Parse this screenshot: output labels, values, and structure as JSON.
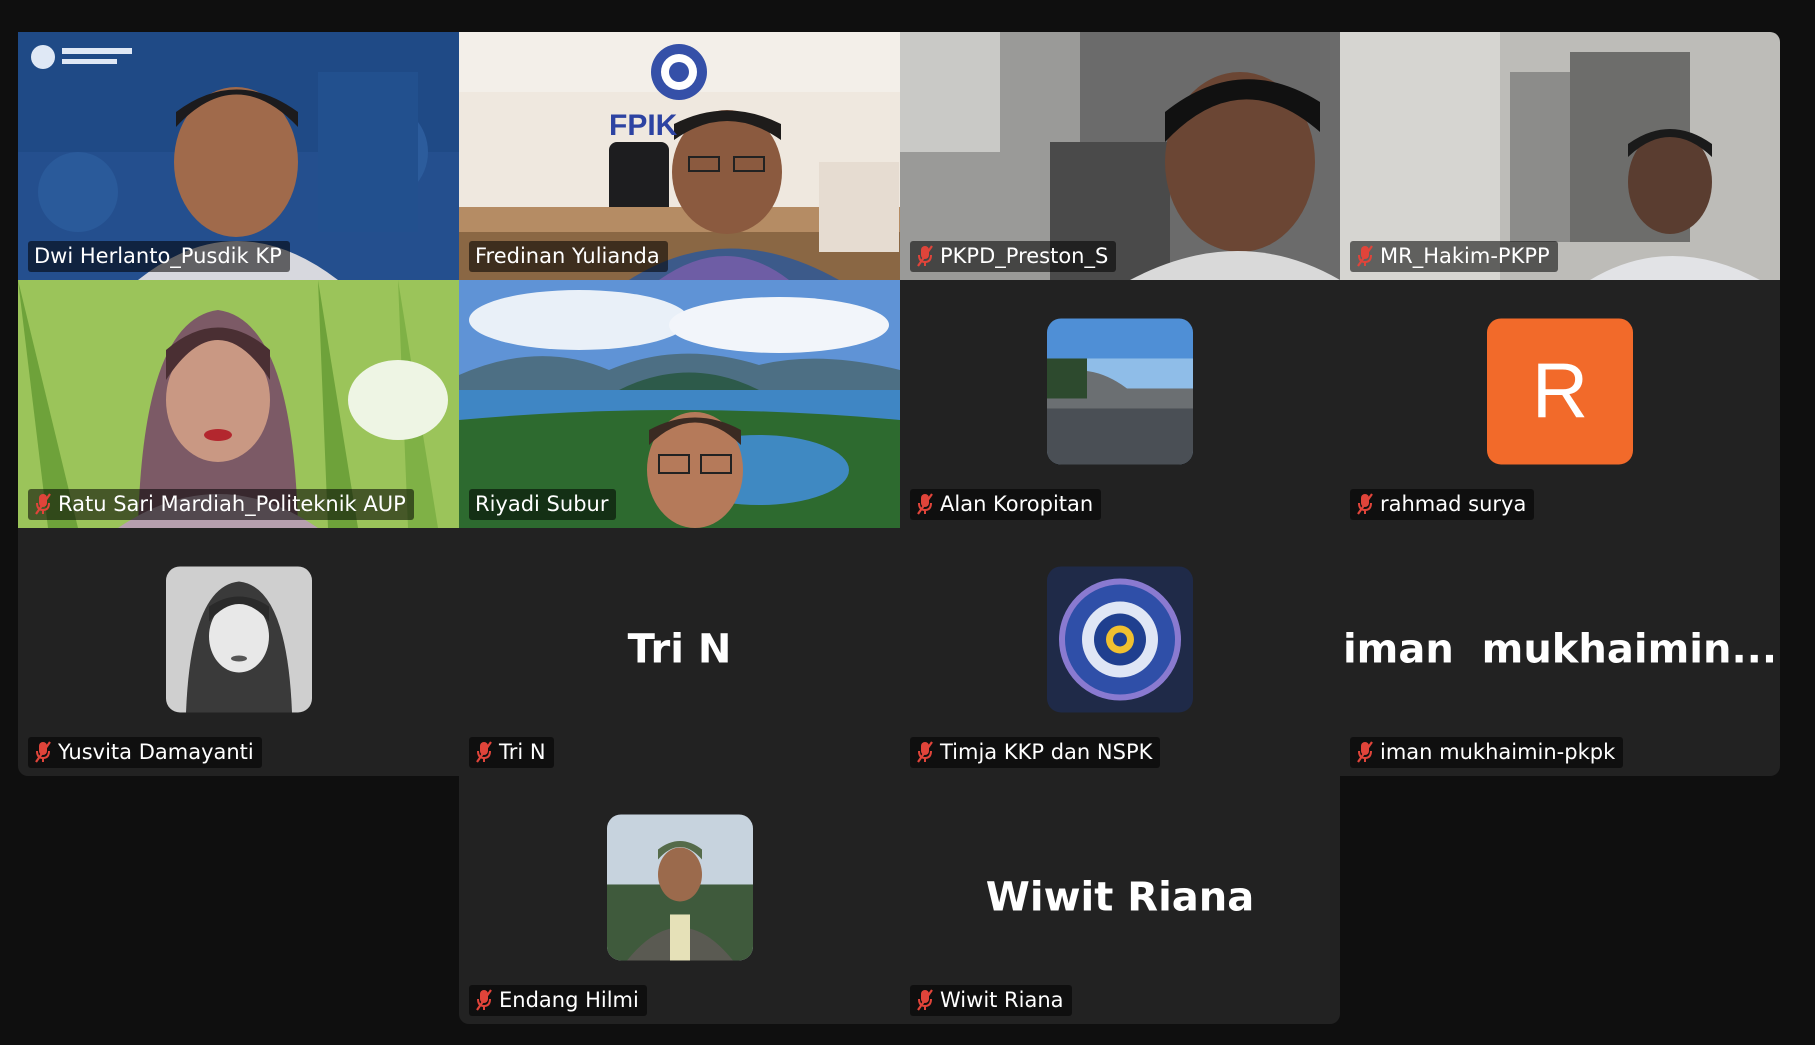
{
  "meeting": {
    "participants": [
      {
        "name": "Dwi Herlanto_Pusdik KP",
        "muted": false,
        "active_speaker": true
      },
      {
        "name": "Fredinan Yulianda",
        "muted": false
      },
      {
        "name": "PKPD_Preston_S",
        "muted": true
      },
      {
        "name": "MR_Hakim-PKPP",
        "muted": true
      },
      {
        "name": "Ratu Sari Mardiah_Politeknik AUP",
        "muted": true
      },
      {
        "name": "Riyadi Subur",
        "muted": false
      },
      {
        "name": "Alan Koropitan",
        "muted": true
      },
      {
        "name": "rahmad surya",
        "muted": true,
        "avatar_letter": "R"
      },
      {
        "name": "Yusvita Damayanti",
        "muted": true
      },
      {
        "name": "Tri N",
        "muted": true,
        "display_name": "Tri N"
      },
      {
        "name": "Timja KKP dan NSPK",
        "muted": true
      },
      {
        "name": "iman mukhaimin-pkpk",
        "muted": true,
        "display_name": "iman  mukhaimin..."
      },
      {
        "name": "Endang Hilmi",
        "muted": true
      },
      {
        "name": "Wiwit Riana",
        "muted": true,
        "display_name": "Wiwit Riana"
      }
    ],
    "backdrop_text": "FPIK",
    "colors": {
      "active_border": "#29d0a4",
      "muted_icon": "#e0443a",
      "avatar_orange": "#f26a2a"
    }
  }
}
